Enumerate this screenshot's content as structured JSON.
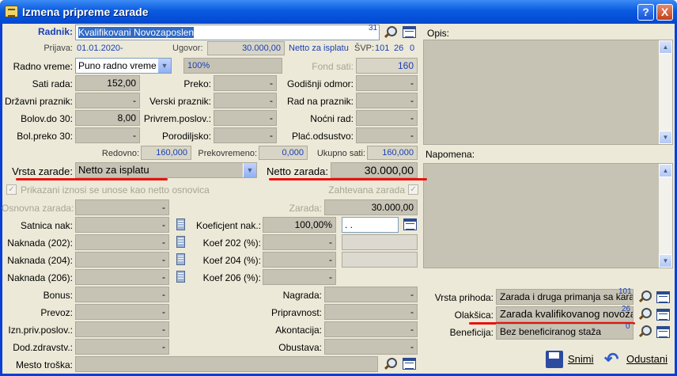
{
  "window": {
    "title": "Izmena pripreme zarade",
    "help": "?",
    "close": "X"
  },
  "radnik": {
    "label": "Radnik:",
    "value": "Kvalifikovani Novozaposlen",
    "code": "31"
  },
  "prijava": {
    "label": "Prijava:",
    "value": "01.01.2020-"
  },
  "ugovor": {
    "label": "Ugovor:",
    "value": "30.000,00",
    "type": "Netto za isplatu"
  },
  "svp": {
    "label": "ŠVP:",
    "v1": "101",
    "v2": "26",
    "v3": "0"
  },
  "opis": {
    "label": "Opis:"
  },
  "radno_vreme": {
    "label": "Radno vreme:",
    "value": "Puno radno vreme",
    "pct": "100%"
  },
  "fond_sati": {
    "label": "Fond sati:",
    "value": "160"
  },
  "left_fields": [
    {
      "label": "Sati rada:",
      "value": "152,00"
    },
    {
      "label": "Državni praznik:",
      "value": "-"
    },
    {
      "label": "Bolov.do 30:",
      "value": "8,00"
    },
    {
      "label": "Bol.preko 30:",
      "value": "-"
    }
  ],
  "mid_fields": [
    {
      "label": "Preko:",
      "value": "-"
    },
    {
      "label": "Verski praznik:",
      "value": "-"
    },
    {
      "label": "Privrem.poslov.:",
      "value": "-"
    },
    {
      "label": "Porodiljsko:",
      "value": "-"
    }
  ],
  "right_fields": [
    {
      "label": "Godišnji odmor:",
      "value": "-"
    },
    {
      "label": "Rad na praznik:",
      "value": "-"
    },
    {
      "label": "Noćni rad:",
      "value": "-"
    },
    {
      "label": "Plać.odsustvo:",
      "value": "-"
    }
  ],
  "totals": {
    "redovno_label": "Redovno:",
    "redovno": "160,000",
    "prekovremeno_label": "Prekovremeno:",
    "prekovremeno": "0,000",
    "ukupno_label": "Ukupno sati:",
    "ukupno": "160,000"
  },
  "napomena": {
    "label": "Napomena:"
  },
  "vrsta_zarade": {
    "label": "Vrsta zarade:",
    "value": "Netto za isplatu"
  },
  "netto_zarada": {
    "label": "Netto zarada:",
    "value": "30.000,00"
  },
  "prikazani": {
    "label": "Prikazani iznosi se unose kao netto osnovica"
  },
  "zahtevana": {
    "label": "Zahtevana zarada"
  },
  "osnovna": {
    "label": "Osnovna zarada:",
    "value": "-"
  },
  "zarada": {
    "label": "Zarada:",
    "value": "30.000,00"
  },
  "satnica": {
    "label": "Satnica nak:",
    "value": "-"
  },
  "koef_nak": {
    "label": "Koeficjent nak.:",
    "value": "100,00%",
    "date": ". ."
  },
  "naknade": [
    {
      "label": "Naknada (202):",
      "value": "-",
      "koef_label": "Koef 202 (%):",
      "koef": "-"
    },
    {
      "label": "Naknada (204):",
      "value": "-",
      "koef_label": "Koef 204 (%):",
      "koef": "-"
    },
    {
      "label": "Naknada (206):",
      "value": "-",
      "koef_label": "Koef 206 (%):",
      "koef": "-"
    }
  ],
  "bottom_left": [
    {
      "label": "Bonus:",
      "value": "-"
    },
    {
      "label": "Prevoz:",
      "value": "-"
    },
    {
      "label": "Izn.priv.poslov.:",
      "value": "-"
    },
    {
      "label": "Dod.zdravstv.:",
      "value": "-"
    }
  ],
  "bottom_mid": [
    {
      "label": "Nagrada:",
      "value": "-"
    },
    {
      "label": "Pripravnost:",
      "value": "-"
    },
    {
      "label": "Akontacija:",
      "value": "-"
    },
    {
      "label": "Obustava:",
      "value": "-"
    }
  ],
  "mesto_troska": {
    "label": "Mesto troška:"
  },
  "vrsta_prihoda": {
    "label": "Vrsta prihoda:",
    "value": "Zarada i druga primanja sa kara",
    "code": "101"
  },
  "olaksica": {
    "label": "Olakšica:",
    "value": "Zarada kvalifikovanog novozapo",
    "code": "26"
  },
  "beneficija": {
    "label": "Beneficija:",
    "value": "Bez beneficiranog staža",
    "code": "0"
  },
  "buttons": {
    "snimi": "Snimi",
    "odustani": "Odustani"
  },
  "colors": {
    "accent_red": "#e8120f",
    "title_blue": "#0a5be0"
  }
}
